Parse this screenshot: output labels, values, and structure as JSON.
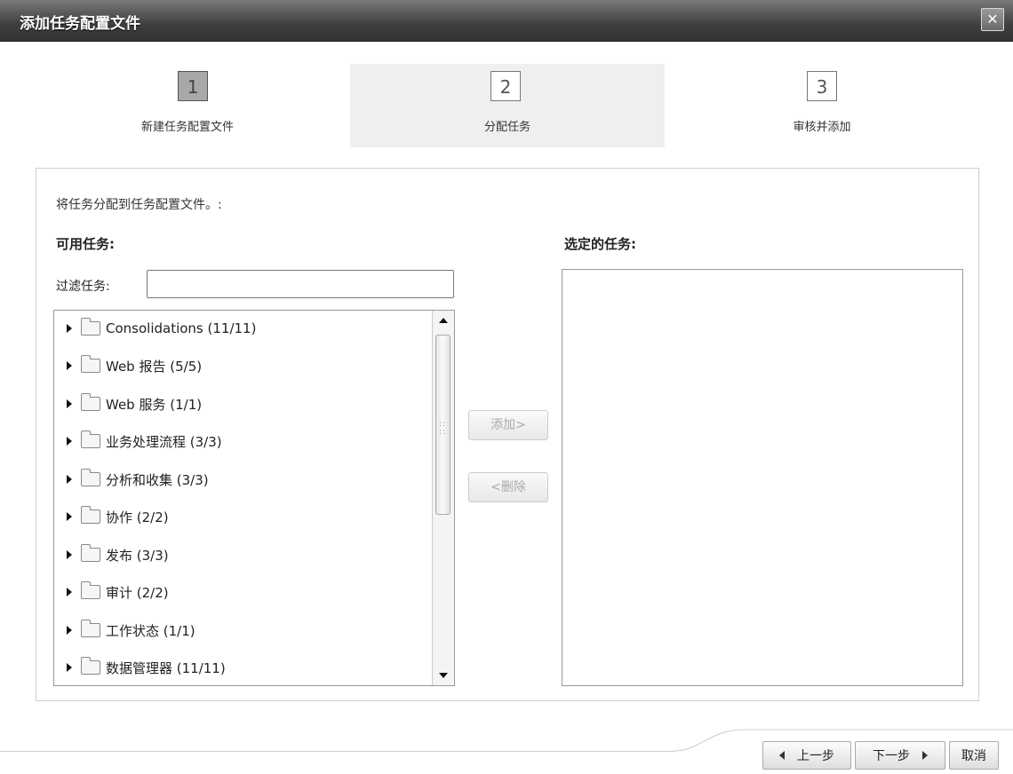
{
  "window": {
    "title": "添加任务配置文件",
    "close_symbol": "✕"
  },
  "steps": [
    {
      "number": "1",
      "label": "新建任务配置文件"
    },
    {
      "number": "2",
      "label": "分配任务"
    },
    {
      "number": "3",
      "label": "审核并添加"
    }
  ],
  "main": {
    "instruction": "将任务分配到任务配置文件。:",
    "available_label": "可用任务:",
    "selected_label": "选定的任务:",
    "filter_label": "过滤任务:",
    "filter_value": "",
    "tree_items": [
      "Consolidations (11/11)",
      "Web 报告 (5/5)",
      "Web 服务 (1/1)",
      "业务处理流程 (3/3)",
      "分析和收集 (3/3)",
      "协作 (2/2)",
      "发布 (3/3)",
      "审计 (2/2)",
      "工作状态 (1/1)",
      "数据管理器 (11/11)"
    ],
    "add_button": "添加>",
    "remove_button": "<删除"
  },
  "footer": {
    "prev_label": "上一步",
    "next_label": "下一步",
    "cancel_label": "取消"
  }
}
